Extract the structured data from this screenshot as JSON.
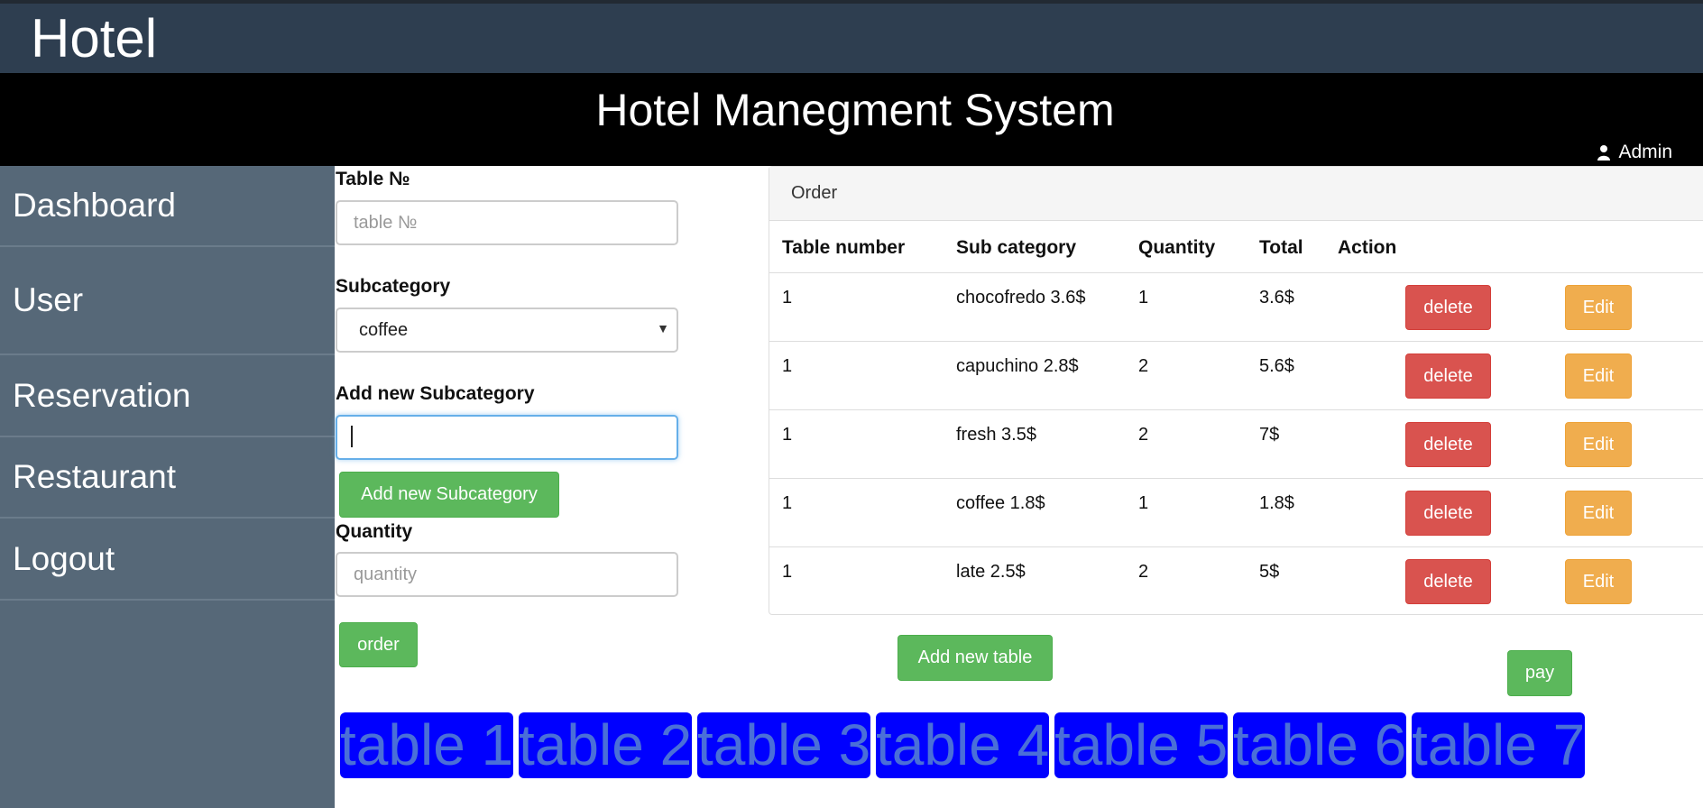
{
  "brand": "Hotel",
  "app_title": "Hotel Manegment System",
  "user": {
    "name": "Admin",
    "icon": "user-icon"
  },
  "sidebar": {
    "items": [
      {
        "label": "Dashboard"
      },
      {
        "label": "User"
      },
      {
        "label": "Reservation"
      },
      {
        "label": "Restaurant"
      },
      {
        "label": "Logout"
      }
    ]
  },
  "form": {
    "table_label": "Table №",
    "table_placeholder": "table №",
    "subcategory_label": "Subcategory",
    "subcategory_selected": "coffee",
    "new_subcategory_label": "Add new Subcategory",
    "new_subcategory_value": "",
    "add_subcategory_button": "Add new Subcategory",
    "quantity_label": "Quantity",
    "quantity_placeholder": "quantity",
    "order_button": "order"
  },
  "order_panel": {
    "title": "Order",
    "columns": [
      "Table number",
      "Sub category",
      "Quantity",
      "Total",
      "Action"
    ],
    "rows": [
      {
        "table": "1",
        "sub": "chocofredo 3.6$",
        "qty": "1",
        "total": "3.6$"
      },
      {
        "table": "1",
        "sub": "capuchino 2.8$",
        "qty": "2",
        "total": "5.6$"
      },
      {
        "table": "1",
        "sub": "fresh 3.5$",
        "qty": "2",
        "total": "7$"
      },
      {
        "table": "1",
        "sub": "coffee 1.8$",
        "qty": "1",
        "total": "1.8$"
      },
      {
        "table": "1",
        "sub": "late 2.5$",
        "qty": "2",
        "total": "5$"
      }
    ],
    "delete_label": "delete",
    "edit_label": "Edit"
  },
  "add_table_button": "Add new table",
  "pay_button": "pay",
  "tables": [
    "table 1",
    "table 2",
    "table 3",
    "table 4",
    "table 5",
    "table 6",
    "table 7"
  ],
  "colors": {
    "brand_bar": "#2e3e50",
    "title_bar": "#000000",
    "sidebar": "#566878",
    "green": "#5cb85c",
    "red": "#d9534f",
    "orange": "#f0ad4e",
    "table_tile": "#0000ff"
  }
}
